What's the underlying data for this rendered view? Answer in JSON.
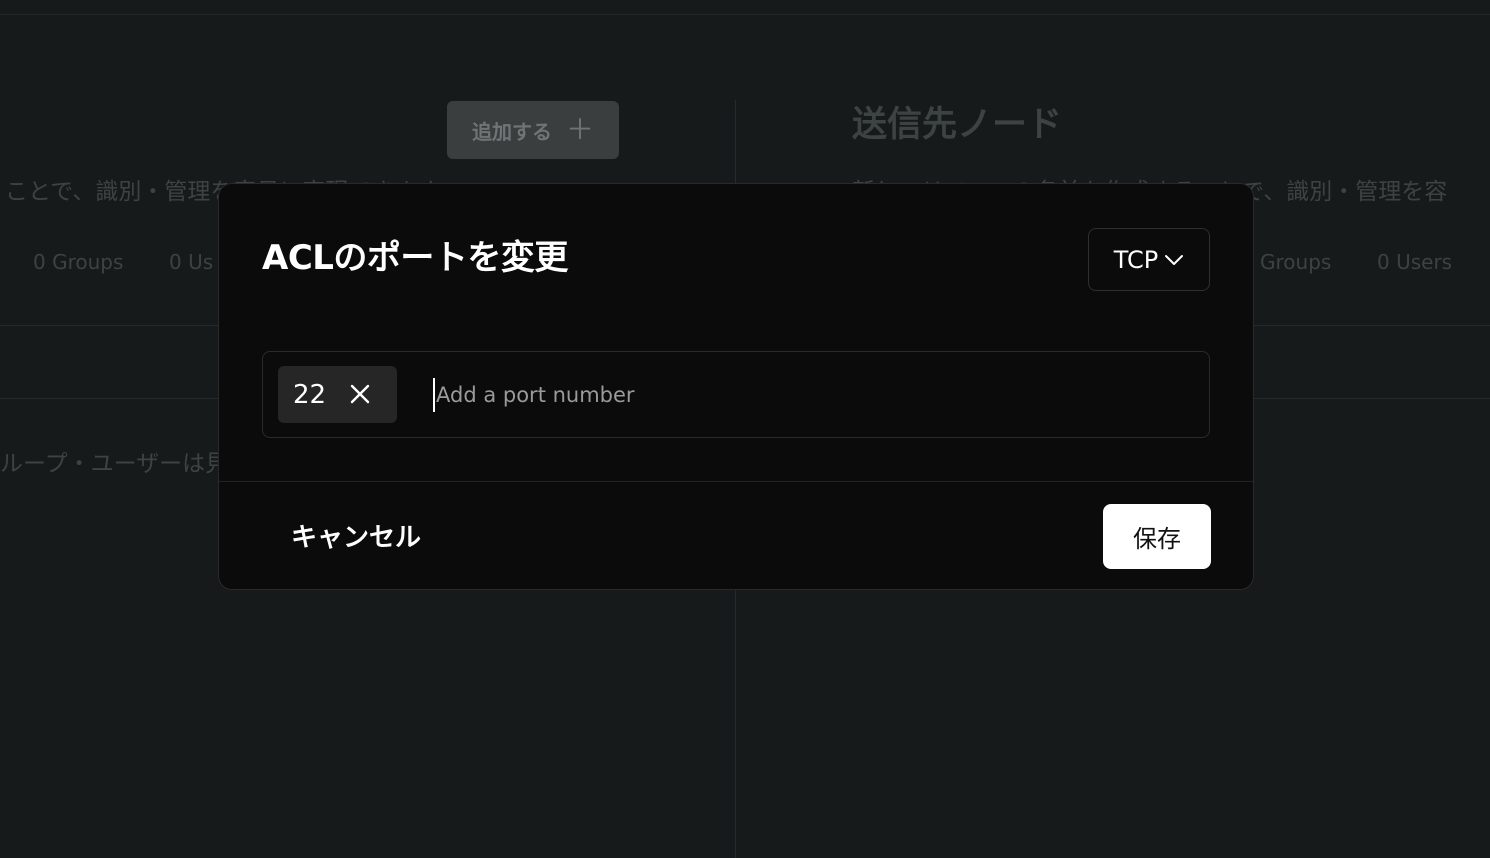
{
  "background": {
    "add_button": {
      "label": "追加する",
      "icon": "plus-icon"
    },
    "left_description": "ことで、識別・管理を容易に実現できます",
    "left_tabs": [
      "0 Groups",
      "0 Us"
    ],
    "left_empty_text": "ループ・ユーザーは見",
    "right_title": "送信先ノード",
    "right_description": "新しいリソースの名前を作成することで、識別・管理を容",
    "right_tabs": [
      "Groups",
      "0 Users"
    ]
  },
  "modal": {
    "title": "ACLのポートを変更",
    "protocol": {
      "selected": "TCP",
      "icon": "chevron-down-icon"
    },
    "ports": [
      "22"
    ],
    "port_input": {
      "value": "",
      "placeholder": "Add a port number"
    },
    "cancel_label": "キャンセル",
    "save_label": "保存"
  },
  "colors": {
    "overlay_bg": "#161a1b",
    "modal_bg": "#0b0b0b",
    "chip_bg": "#262626",
    "primary_button_bg": "#ffffff",
    "primary_button_text": "#111111",
    "placeholder": "#9a9a9a"
  }
}
